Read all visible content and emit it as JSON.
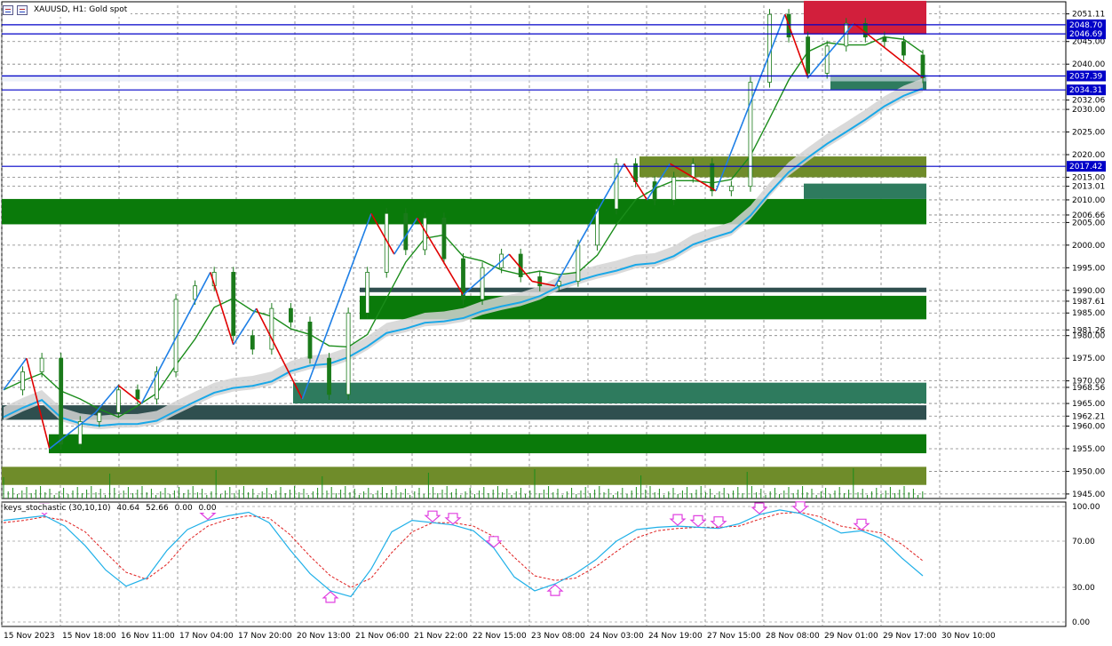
{
  "window": {
    "title": "XAUUSD, H1:  Gold spot"
  },
  "indicator": {
    "name": "keys_stochastic (30,10,10)",
    "values": [
      "40.64",
      "52.66",
      "0.00",
      "0.00"
    ]
  },
  "colors": {
    "up_leg": "#1e7fe6",
    "down_leg": "#e00000",
    "ma_slow": "#19a8e8",
    "ma_fast": "#1a8c1a",
    "band": "#d3d3d3",
    "level_line": "#0000c8",
    "zone_green": "#0a7a0a",
    "zone_olive": "#6f8c2a",
    "zone_teal": "#2e7b5e",
    "zone_slate": "#2f4f4f",
    "zone_red": "#d21f3c",
    "stoch_main": "#20b0e8",
    "stoch_signal": "#e02020",
    "arrow": "#e040e0"
  },
  "chart_data": [
    {
      "type": "candlestick",
      "symbol": "XAUUSD",
      "timeframe": "H1",
      "ylim": [
        1944,
        2053
      ],
      "price_ticks": [
        "2051.11",
        "2045.00",
        "2040.00",
        "2032.06",
        "2030.00",
        "2025.00",
        "2020.00",
        "2015.00",
        "2013.01",
        "2010.00",
        "2006.66",
        "2005.00",
        "2000.00",
        "1995.00",
        "1990.00",
        "1987.61",
        "1985.00",
        "1981.26",
        "1980.00",
        "1975.00",
        "1970.00",
        "1968.56",
        "1965.00",
        "1962.21",
        "1960.00",
        "1955.00",
        "1950.00",
        "1945.00"
      ],
      "level_labels": [
        {
          "label": "2048.70",
          "price": 2048.7
        },
        {
          "label": "2046.69",
          "price": 2046.69
        },
        {
          "label": "2037.39",
          "price": 2037.39
        },
        {
          "label": "2034.31",
          "price": 2034.31
        },
        {
          "label": "2017.42",
          "price": 2017.42
        }
      ],
      "time_labels": [
        "15 Nov 2023",
        "15 Nov 18:00",
        "16 Nov 11:00",
        "17 Nov 04:00",
        "17 Nov 20:00",
        "20 Nov 13:00",
        "21 Nov 06:00",
        "21 Nov 22:00",
        "22 Nov 15:00",
        "23 Nov 08:00",
        "24 Nov 03:00",
        "24 Nov 19:00",
        "27 Nov 15:00",
        "28 Nov 08:00",
        "29 Nov 01:00",
        "29 Nov 17:00",
        "30 Nov 10:00"
      ],
      "zigzag": [
        [
          0,
          1968
        ],
        [
          1,
          1975
        ],
        [
          2,
          1955
        ],
        [
          4,
          1963
        ],
        [
          5,
          1969
        ],
        [
          6,
          1965
        ],
        [
          9,
          1994
        ],
        [
          10,
          1978
        ],
        [
          11,
          1986
        ],
        [
          13,
          1966
        ],
        [
          16,
          2007
        ],
        [
          17,
          1998
        ],
        [
          18,
          2006
        ],
        [
          20,
          1989
        ],
        [
          22,
          1998
        ],
        [
          23,
          1992
        ],
        [
          24,
          1991
        ],
        [
          27,
          2018
        ],
        [
          28,
          2010
        ],
        [
          29,
          2018
        ],
        [
          31,
          2012
        ],
        [
          34,
          2051
        ],
        [
          35,
          2037
        ],
        [
          37,
          2049
        ],
        [
          40,
          2037
        ]
      ],
      "closes": [
        1968,
        1972,
        1975,
        1956,
        1961,
        1963,
        1968,
        1966,
        1972,
        1988,
        1991,
        1994,
        1980,
        1977,
        1986,
        1983,
        1975,
        1967,
        1985,
        1994,
        2007,
        1999,
        2006,
        1997,
        1988,
        1995,
        1998,
        1993,
        1991,
        1992,
        2000,
        2008,
        2018,
        2014,
        2010,
        2015,
        2018,
        2012,
        2013,
        2036,
        2051,
        2046,
        2038,
        2044,
        2049,
        2046,
        2045,
        2042,
        2037
      ]
    },
    {
      "type": "line",
      "name": "keys_stochastic (30,10,10)",
      "ylim": [
        0,
        100
      ],
      "y_ticks": [
        "100.00",
        "70.00",
        "30.00",
        "0.00"
      ],
      "series": [
        {
          "name": "main",
          "values": [
            88,
            90,
            92,
            83,
            66,
            45,
            31,
            38,
            62,
            80,
            88,
            92,
            95,
            86,
            63,
            42,
            27,
            22,
            46,
            78,
            88,
            86,
            84,
            79,
            64,
            39,
            27,
            33,
            42,
            54,
            70,
            80,
            82,
            83,
            82,
            81,
            85,
            93,
            97,
            94,
            86,
            77,
            79,
            72,
            55,
            40
          ]
        },
        {
          "name": "signal",
          "values": [
            86,
            88,
            91,
            88,
            78,
            60,
            43,
            37,
            50,
            70,
            83,
            89,
            92,
            90,
            76,
            57,
            40,
            30,
            38,
            60,
            78,
            86,
            86,
            83,
            74,
            56,
            40,
            36,
            38,
            48,
            61,
            73,
            79,
            81,
            82,
            82,
            83,
            89,
            94,
            95,
            91,
            83,
            80,
            77,
            67,
            53
          ]
        }
      ],
      "arrows": [
        {
          "i": 2,
          "dir": "down"
        },
        {
          "i": 10,
          "dir": "down"
        },
        {
          "i": 16,
          "dir": "up"
        },
        {
          "i": 21,
          "dir": "down"
        },
        {
          "i": 22,
          "dir": "down"
        },
        {
          "i": 24,
          "dir": "down"
        },
        {
          "i": 27,
          "dir": "up"
        },
        {
          "i": 33,
          "dir": "down"
        },
        {
          "i": 34,
          "dir": "down"
        },
        {
          "i": 35,
          "dir": "down"
        },
        {
          "i": 37,
          "dir": "down"
        },
        {
          "i": 39,
          "dir": "down"
        },
        {
          "i": 42,
          "dir": "down"
        }
      ]
    }
  ]
}
